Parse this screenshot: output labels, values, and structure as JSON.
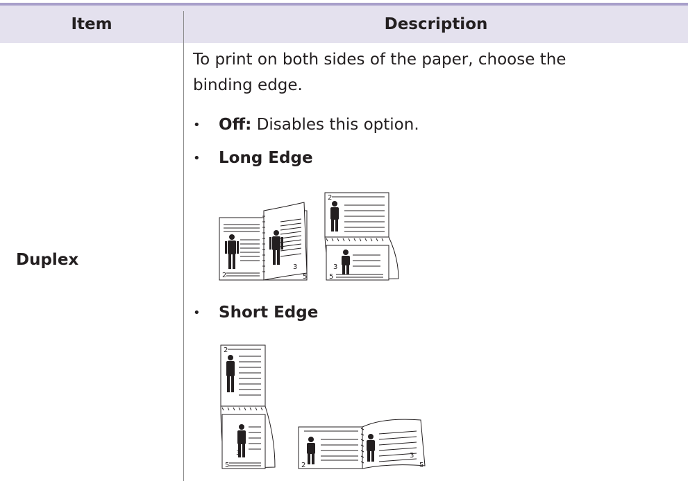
{
  "table": {
    "headers": {
      "item": "Item",
      "description": "Description"
    },
    "row": {
      "item": "Duplex",
      "intro": "To print on both sides of the paper, choose the binding edge.",
      "options": [
        {
          "label": "Off:",
          "text": " Disables this option."
        },
        {
          "label": "Long Edge",
          "text": ""
        },
        {
          "label": "Short Edge",
          "text": ""
        }
      ]
    }
  },
  "figures": {
    "long_edge": {
      "left_page_a": "2",
      "left_page_b": "3",
      "left_page_c": "5",
      "right_page_a": "2",
      "right_page_b": "3",
      "right_page_c": "5"
    },
    "short_edge": {
      "top_page_a": "2",
      "top_page_b": "3",
      "top_page_c": "5",
      "right_page_a": "2",
      "right_page_b": "3",
      "right_page_c": "5"
    }
  }
}
